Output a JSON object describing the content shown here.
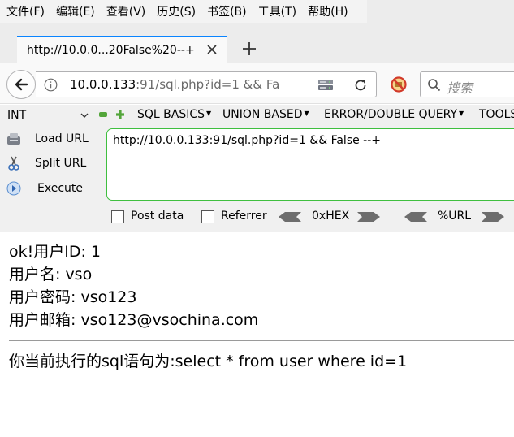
{
  "menubar": {
    "items": [
      "文件(F)",
      "编辑(E)",
      "查看(V)",
      "历史(S)",
      "书签(B)",
      "工具(T)",
      "帮助(H)"
    ]
  },
  "tab": {
    "title": "http://10.0.0...20False%20--+"
  },
  "navbar": {
    "url_host": "10.0.0.133",
    "url_rest": ":91/sql.php?id=1 && Fa",
    "search_placeholder": "搜索"
  },
  "hackbar": {
    "type_select": "INT",
    "menus": [
      "SQL BASICS",
      "UNION BASED",
      "ERROR/DOUBLE QUERY",
      "TOOLS"
    ],
    "load_url": "Load URL",
    "split_url": "Split URL",
    "execute": "Execute",
    "url_value": "http://10.0.0.133:91/sql.php?id=1 && False --+",
    "post_data": "Post data",
    "referrer": "Referrer",
    "hex": "0xHEX",
    "urlenc": "%URL"
  },
  "page": {
    "line1": "ok!用户ID: 1",
    "line2": "用户名: vso",
    "line3": "用户密码: vso123",
    "line4": "用户邮箱: vso123@vsochina.com",
    "sql": "你当前执行的sql语句为:select * from user where id=1"
  },
  "colors": {
    "tab_accent": "#0a84ff",
    "hackbar_green": "#3fbf3f"
  }
}
